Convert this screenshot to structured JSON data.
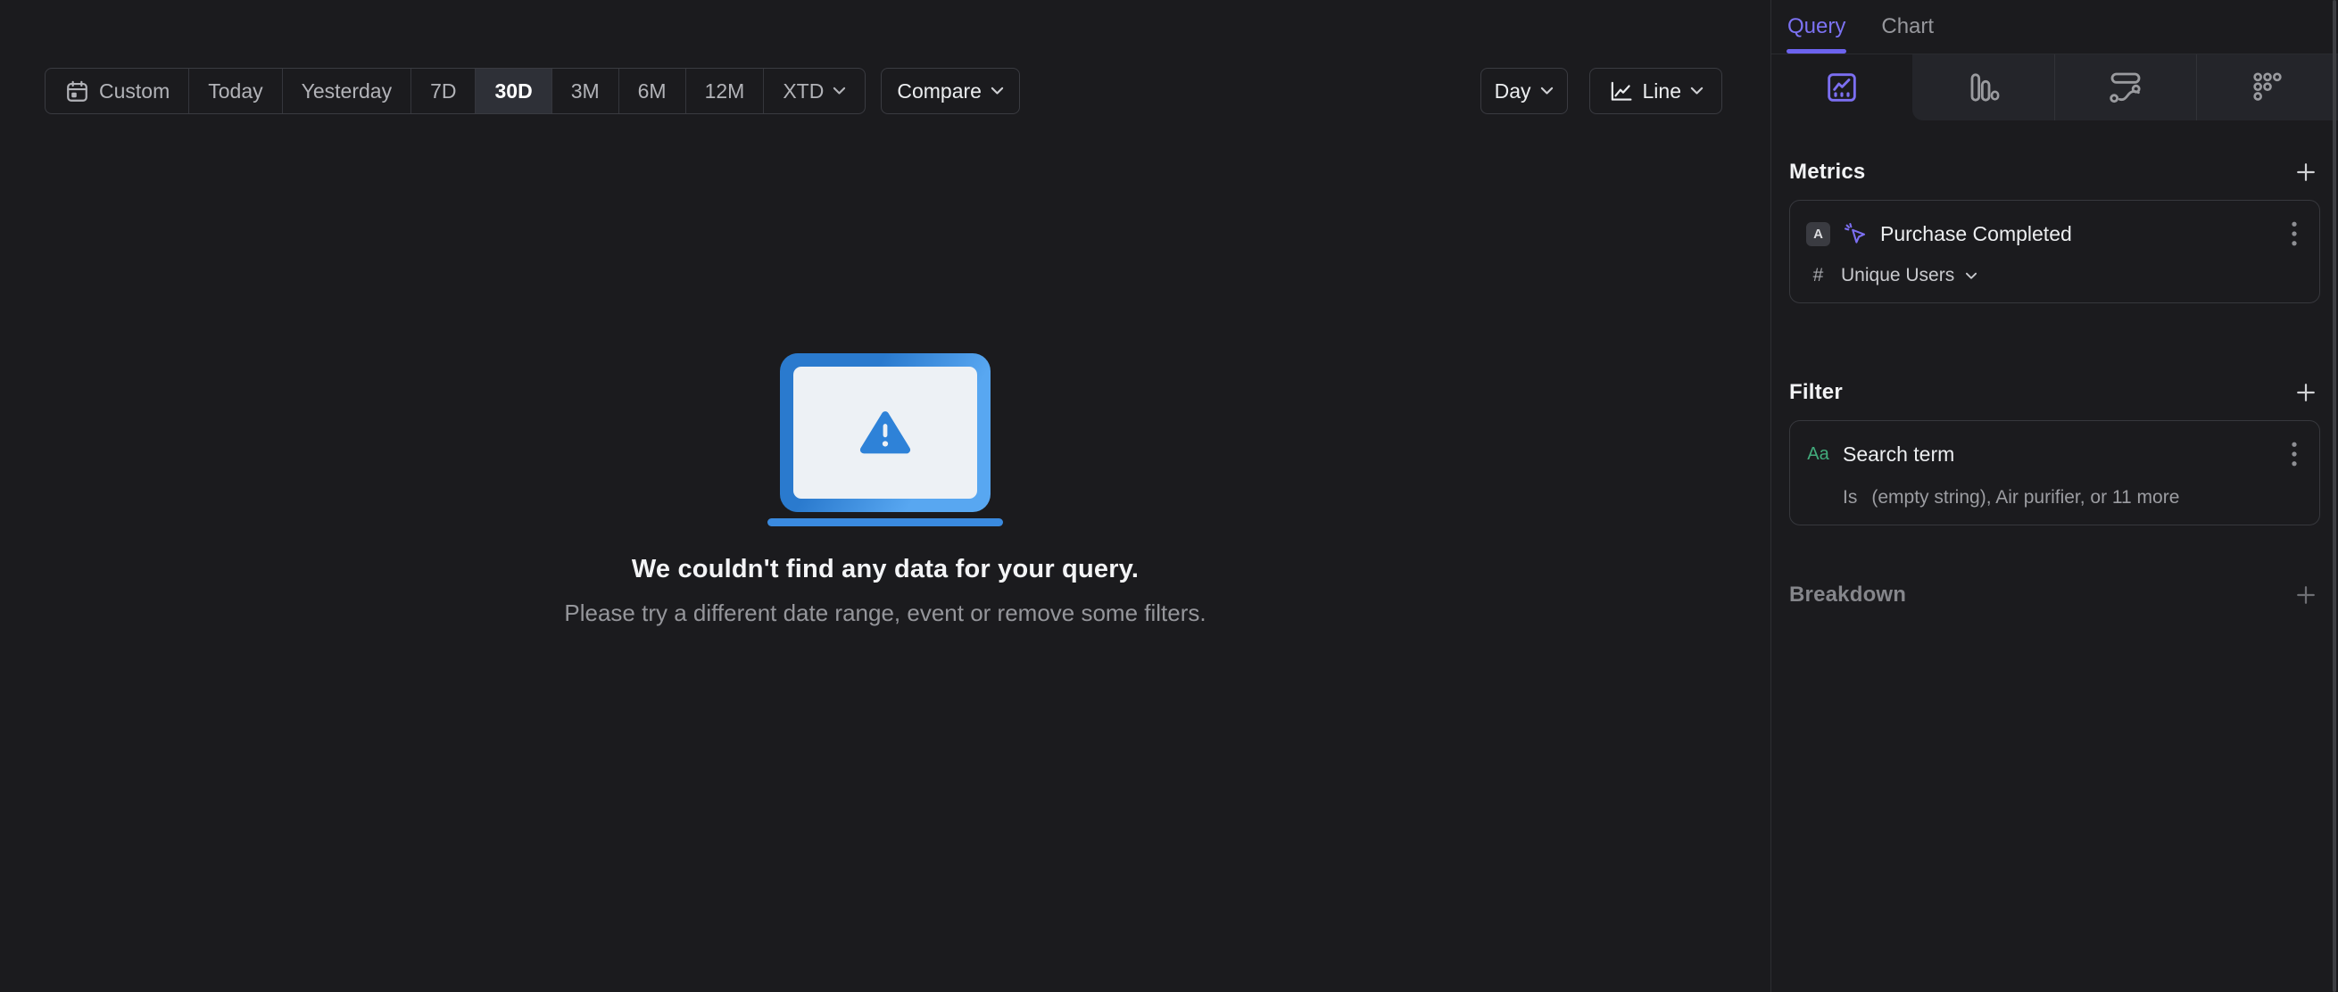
{
  "toolbar": {
    "ranges": [
      "Custom",
      "Today",
      "Yesterday",
      "7D",
      "30D",
      "3M",
      "6M",
      "12M",
      "XTD"
    ],
    "selected_range": "30D",
    "compare_label": "Compare",
    "granularity_label": "Day",
    "chart_type_label": "Line"
  },
  "empty_state": {
    "title": "We couldn't find any data for your query.",
    "subtitle": "Please try a different date range, event or remove some filters."
  },
  "sidebar": {
    "tabs": {
      "query": "Query",
      "chart": "Chart"
    },
    "metrics": {
      "title": "Metrics",
      "card": {
        "letter": "A",
        "event_name": "Purchase Completed",
        "aggregation_symbol": "#",
        "aggregation_label": "Unique Users"
      }
    },
    "filter": {
      "title": "Filter",
      "card": {
        "type_label": "Aa",
        "property_name": "Search term",
        "operator": "Is",
        "values_summary": "(empty string), Air purifier, or 11 more"
      }
    },
    "breakdown": {
      "title": "Breakdown"
    }
  },
  "icons": {
    "calendar": "calendar-icon",
    "chevron": "chevron-down-icon",
    "line_chart": "line-chart-icon",
    "insights_tab": "insights-chart-icon",
    "funnels_tab": "bar-chart-icon",
    "flows_tab": "flows-icon",
    "retention_tab": "retention-dots-icon",
    "event": "event-cursor-icon",
    "warning": "warning-triangle-icon",
    "add": "plus-icon",
    "menu": "kebab-menu-icon"
  },
  "colors": {
    "background": "#1b1b1e",
    "accent_purple": "#7c72f3",
    "brand_blue": "#2e82d8",
    "property_green": "#42ab7c",
    "selected_range_bg": "#2e3037"
  }
}
